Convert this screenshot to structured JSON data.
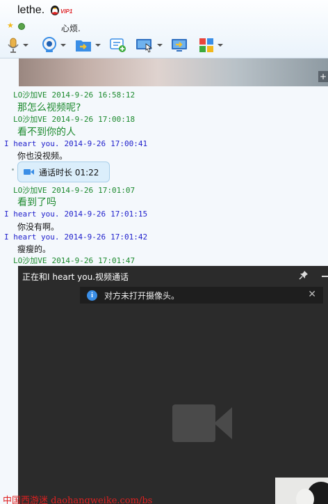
{
  "contact": {
    "nickname": "lethe.",
    "vip_label": "VIP1",
    "signature": "心烦."
  },
  "toolbar": {
    "items": [
      {
        "icon": "microphone-icon",
        "has_dropdown": true
      },
      {
        "icon": "webcam-icon",
        "has_dropdown": true
      },
      {
        "icon": "send-file-icon",
        "has_dropdown": true
      },
      {
        "icon": "add-chat-icon",
        "has_dropdown": false
      },
      {
        "icon": "remote-assist-icon",
        "has_dropdown": true
      },
      {
        "icon": "screen-share-icon",
        "has_dropdown": false
      },
      {
        "icon": "apps-icon",
        "has_dropdown": true
      }
    ]
  },
  "messages": [
    {
      "sender": "LO沙加VE",
      "date": "2014-9-26",
      "time": "16:58:12",
      "text": "那怎么视频呢?",
      "style": "incoming"
    },
    {
      "sender": "LO沙加VE",
      "date": "2014-9-26",
      "time": "17:00:18",
      "text": "看不到你的人",
      "style": "incoming"
    },
    {
      "sender": "I heart you.",
      "date": "2014-9-26",
      "time": "17:00:41",
      "text": "你也没视频。",
      "style": "outgoing"
    },
    {
      "sender": "LO沙加VE",
      "date": "2014-9-26",
      "time": "17:01:07",
      "text": "看到了吗",
      "style": "incoming"
    },
    {
      "sender": "I heart you.",
      "date": "2014-9-26",
      "time": "17:01:15",
      "text": "你没有啊。",
      "style": "outgoing"
    },
    {
      "sender": "I heart you.",
      "date": "2014-9-26",
      "time": "17:01:42",
      "text": "瘦瘦的。",
      "style": "outgoing"
    },
    {
      "sender": "LO沙加VE",
      "date": "2014-9-26",
      "time": "17:01:47",
      "text": "",
      "style": "incoming"
    }
  ],
  "call_bubble": {
    "text": "通话时长 01:22"
  },
  "video_panel": {
    "title": "正在和I heart you.视频通话",
    "notice": "对方未打开摄像头。"
  },
  "watermark": "中国西游迷 daohangweike.com/bs",
  "colors": {
    "incoming_name": "#1c8a2e",
    "outgoing_name": "#1e1ecc",
    "video_bg": "#2b2b2b",
    "call_bubble_bg": "#dbeefb",
    "info_blue": "#3a8ee6"
  }
}
